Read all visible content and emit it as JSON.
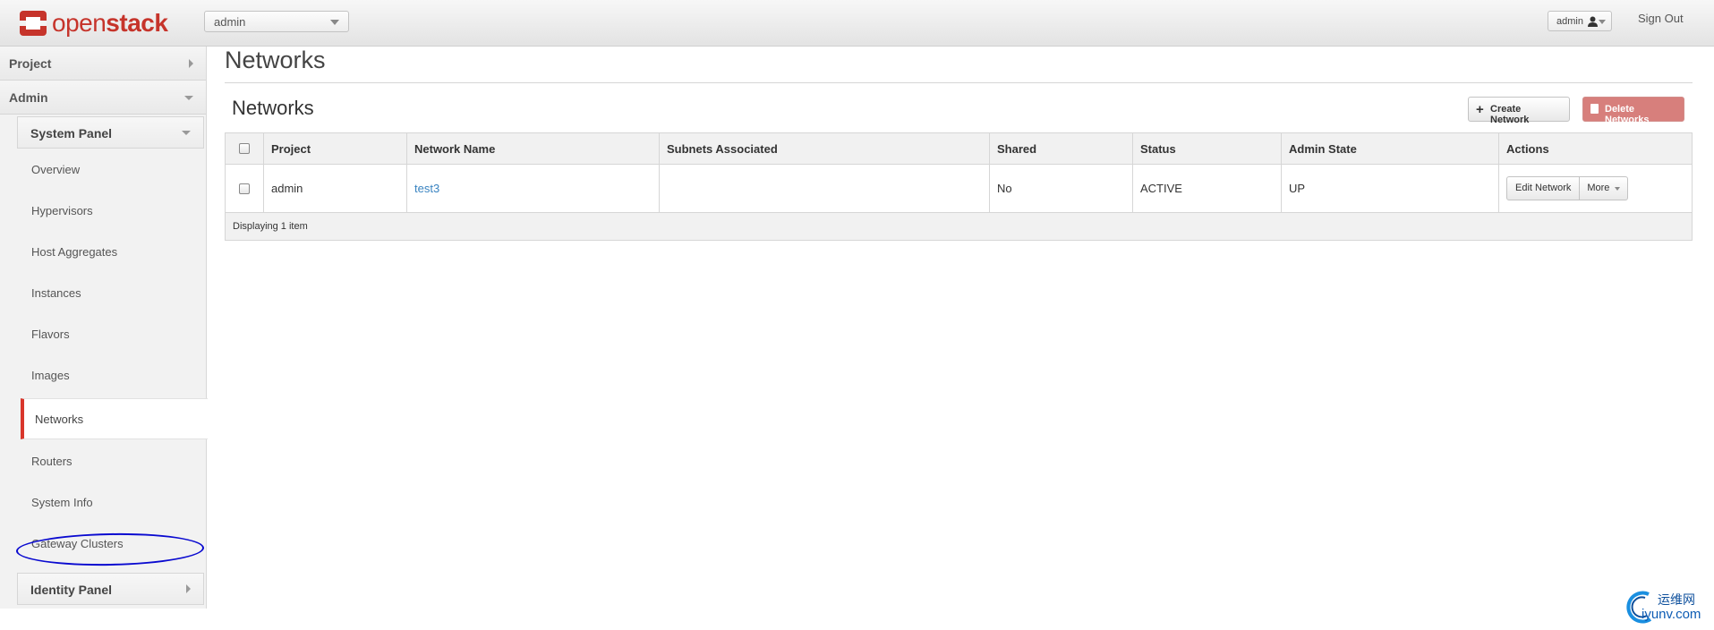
{
  "header": {
    "logo_open": "open",
    "logo_stack": "stack",
    "project_selector": "admin",
    "user_menu": "admin",
    "sign_out": "Sign Out"
  },
  "sidebar": {
    "dashboards": [
      {
        "label": "Project"
      },
      {
        "label": "Admin"
      }
    ],
    "panel_group": "System Panel",
    "items": [
      {
        "label": "Overview"
      },
      {
        "label": "Hypervisors"
      },
      {
        "label": "Host Aggregates"
      },
      {
        "label": "Instances"
      },
      {
        "label": "Flavors"
      },
      {
        "label": "Images"
      },
      {
        "label": "Networks"
      },
      {
        "label": "Routers"
      },
      {
        "label": "System Info"
      },
      {
        "label": "Gateway Clusters"
      }
    ],
    "active_item": "Networks",
    "identity_panel": "Identity Panel"
  },
  "main": {
    "page_title": "Networks",
    "table_title": "Networks",
    "create_button": "Create Network",
    "delete_button": "Delete Networks",
    "columns": [
      "Project",
      "Network Name",
      "Subnets Associated",
      "Shared",
      "Status",
      "Admin State",
      "Actions"
    ],
    "rows": [
      {
        "project": "admin",
        "network_name": "test3",
        "subnets": "",
        "shared": "No",
        "status": "ACTIVE",
        "admin_state": "UP",
        "action_edit": "Edit Network",
        "action_more": "More"
      }
    ],
    "footer": "Displaying 1 item"
  },
  "watermark": {
    "line1": "运维网",
    "line2": "iyunv.com"
  },
  "colors": {
    "brand": "#c6342b",
    "active_marker": "#d9362b",
    "link": "#3a84c1",
    "danger_button": "#d77f7c",
    "annotation_circle": "#0a0ad0"
  }
}
